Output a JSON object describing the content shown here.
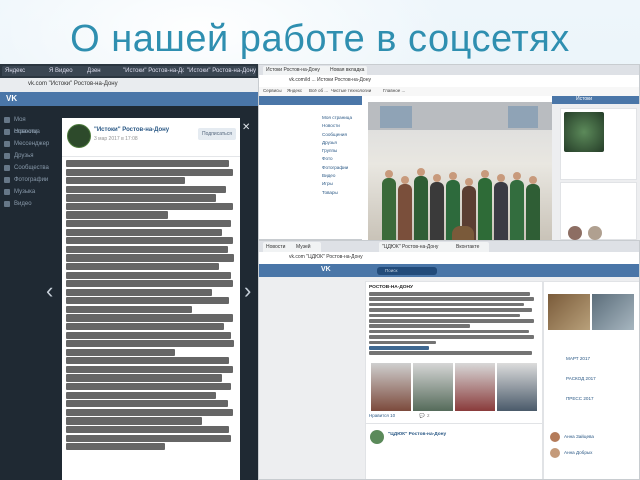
{
  "slide": {
    "title": "О нашей работе в соцсетях"
  },
  "colors": {
    "title": "#2f8fb0",
    "vk_blue": "#4a76a8",
    "vk_link": "#2a5885"
  },
  "shot1": {
    "tabs": [
      "Яндекс",
      "Я Видео",
      "Дзен",
      "\"Истоки\" Ростов-на-Дону",
      "\"Истоки\" Ростов-на-Дону"
    ],
    "address": "vk.com  \"Истоки\" Ростов-на-Дону",
    "logo": "VK",
    "sidebar": [
      "Моя страница",
      "Новости",
      "Мессенджер",
      "Друзья",
      "Сообщества",
      "Фотографии",
      "Музыка",
      "Видео"
    ],
    "post": {
      "author": "\"Истоки\" Ростов-на-Дону",
      "date": "3 мар 2017 в 17:08",
      "subscribe": "Подписаться"
    }
  },
  "shot2": {
    "tabs": [
      "Истоки Ростов-на-Дону",
      "Новая вкладка"
    ],
    "address": "vk.com/id ... Истоки Ростов-на-Дону",
    "bookmarks": [
      "Сервисы",
      "Яндекс",
      "Всё об ...",
      "Чистые технологии",
      "Главное ..."
    ],
    "sidebar": [
      "Моя страница",
      "Новости",
      "Сообщения",
      "Друзья",
      "Группы",
      "Фото",
      "Фотографии",
      "Видео",
      "Игры",
      "Товары"
    ],
    "right_user": "Истоки"
  },
  "shot3": {
    "tabs": [
      "Новости",
      "Музей",
      "\"ЦДЮК\" Ростов-на-Дону",
      "Вконтакте"
    ],
    "address": "vk.com  \"ЦДЮК\" Ростов-на-Дону",
    "logo": "VK",
    "search_placeholder": "Поиск",
    "feed_heading": "РОСТОВ-НА-ДОНУ",
    "likes": "Нравится  10",
    "comments": "2",
    "second_post_author": "\"ЦДЮК\" Ростов-на-Дону",
    "right_items": [
      "МАРТ 2017",
      "РАСКОД 2017",
      "ПРЕСС 2017"
    ],
    "right_people": [
      "Анна Зайцева",
      "Анна Добрых"
    ]
  }
}
